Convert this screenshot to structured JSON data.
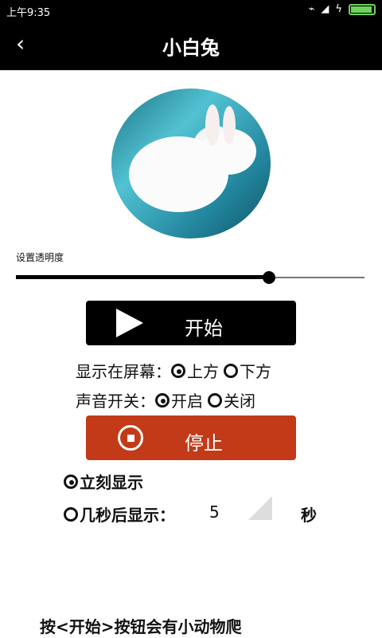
{
  "status_bar": {
    "time": "上午9:35"
  },
  "header": {
    "back_icon": "chevron-left-icon",
    "title": "小白兔"
  },
  "transparency": {
    "label": "设置透明度",
    "value": 0.72
  },
  "start_button": {
    "icon": "play-icon",
    "label": "开始"
  },
  "position_option": {
    "label": "显示在屏幕：",
    "options": [
      "上方",
      "下方"
    ],
    "selected": "上方"
  },
  "sound_option": {
    "label": "声音开关：",
    "options": [
      "开启",
      "关闭"
    ],
    "selected": "开启"
  },
  "stop_button": {
    "icon": "stop-icon",
    "label": "停止"
  },
  "show_options": {
    "immediate": "立刻显示",
    "delayed": "几秒后显示：",
    "selected": "立刻显示"
  },
  "seconds": {
    "value": "5",
    "unit": "秒"
  },
  "footer": {
    "text": "按<开始>按钮会有小动物爬"
  }
}
